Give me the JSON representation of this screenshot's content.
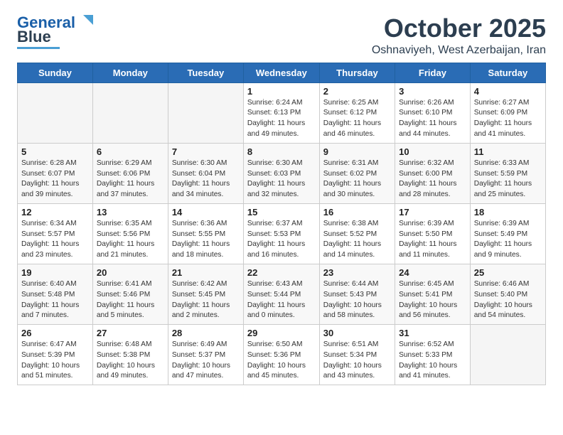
{
  "logo": {
    "line1": "General",
    "line2": "Blue"
  },
  "header": {
    "title": "October 2025",
    "subtitle": "Oshnaviyeh, West Azerbaijan, Iran"
  },
  "weekdays": [
    "Sunday",
    "Monday",
    "Tuesday",
    "Wednesday",
    "Thursday",
    "Friday",
    "Saturday"
  ],
  "weeks": [
    [
      {
        "day": "",
        "info": ""
      },
      {
        "day": "",
        "info": ""
      },
      {
        "day": "",
        "info": ""
      },
      {
        "day": "1",
        "info": "Sunrise: 6:24 AM\nSunset: 6:13 PM\nDaylight: 11 hours\nand 49 minutes."
      },
      {
        "day": "2",
        "info": "Sunrise: 6:25 AM\nSunset: 6:12 PM\nDaylight: 11 hours\nand 46 minutes."
      },
      {
        "day": "3",
        "info": "Sunrise: 6:26 AM\nSunset: 6:10 PM\nDaylight: 11 hours\nand 44 minutes."
      },
      {
        "day": "4",
        "info": "Sunrise: 6:27 AM\nSunset: 6:09 PM\nDaylight: 11 hours\nand 41 minutes."
      }
    ],
    [
      {
        "day": "5",
        "info": "Sunrise: 6:28 AM\nSunset: 6:07 PM\nDaylight: 11 hours\nand 39 minutes."
      },
      {
        "day": "6",
        "info": "Sunrise: 6:29 AM\nSunset: 6:06 PM\nDaylight: 11 hours\nand 37 minutes."
      },
      {
        "day": "7",
        "info": "Sunrise: 6:30 AM\nSunset: 6:04 PM\nDaylight: 11 hours\nand 34 minutes."
      },
      {
        "day": "8",
        "info": "Sunrise: 6:30 AM\nSunset: 6:03 PM\nDaylight: 11 hours\nand 32 minutes."
      },
      {
        "day": "9",
        "info": "Sunrise: 6:31 AM\nSunset: 6:02 PM\nDaylight: 11 hours\nand 30 minutes."
      },
      {
        "day": "10",
        "info": "Sunrise: 6:32 AM\nSunset: 6:00 PM\nDaylight: 11 hours\nand 28 minutes."
      },
      {
        "day": "11",
        "info": "Sunrise: 6:33 AM\nSunset: 5:59 PM\nDaylight: 11 hours\nand 25 minutes."
      }
    ],
    [
      {
        "day": "12",
        "info": "Sunrise: 6:34 AM\nSunset: 5:57 PM\nDaylight: 11 hours\nand 23 minutes."
      },
      {
        "day": "13",
        "info": "Sunrise: 6:35 AM\nSunset: 5:56 PM\nDaylight: 11 hours\nand 21 minutes."
      },
      {
        "day": "14",
        "info": "Sunrise: 6:36 AM\nSunset: 5:55 PM\nDaylight: 11 hours\nand 18 minutes."
      },
      {
        "day": "15",
        "info": "Sunrise: 6:37 AM\nSunset: 5:53 PM\nDaylight: 11 hours\nand 16 minutes."
      },
      {
        "day": "16",
        "info": "Sunrise: 6:38 AM\nSunset: 5:52 PM\nDaylight: 11 hours\nand 14 minutes."
      },
      {
        "day": "17",
        "info": "Sunrise: 6:39 AM\nSunset: 5:50 PM\nDaylight: 11 hours\nand 11 minutes."
      },
      {
        "day": "18",
        "info": "Sunrise: 6:39 AM\nSunset: 5:49 PM\nDaylight: 11 hours\nand 9 minutes."
      }
    ],
    [
      {
        "day": "19",
        "info": "Sunrise: 6:40 AM\nSunset: 5:48 PM\nDaylight: 11 hours\nand 7 minutes."
      },
      {
        "day": "20",
        "info": "Sunrise: 6:41 AM\nSunset: 5:46 PM\nDaylight: 11 hours\nand 5 minutes."
      },
      {
        "day": "21",
        "info": "Sunrise: 6:42 AM\nSunset: 5:45 PM\nDaylight: 11 hours\nand 2 minutes."
      },
      {
        "day": "22",
        "info": "Sunrise: 6:43 AM\nSunset: 5:44 PM\nDaylight: 11 hours\nand 0 minutes."
      },
      {
        "day": "23",
        "info": "Sunrise: 6:44 AM\nSunset: 5:43 PM\nDaylight: 10 hours\nand 58 minutes."
      },
      {
        "day": "24",
        "info": "Sunrise: 6:45 AM\nSunset: 5:41 PM\nDaylight: 10 hours\nand 56 minutes."
      },
      {
        "day": "25",
        "info": "Sunrise: 6:46 AM\nSunset: 5:40 PM\nDaylight: 10 hours\nand 54 minutes."
      }
    ],
    [
      {
        "day": "26",
        "info": "Sunrise: 6:47 AM\nSunset: 5:39 PM\nDaylight: 10 hours\nand 51 minutes."
      },
      {
        "day": "27",
        "info": "Sunrise: 6:48 AM\nSunset: 5:38 PM\nDaylight: 10 hours\nand 49 minutes."
      },
      {
        "day": "28",
        "info": "Sunrise: 6:49 AM\nSunset: 5:37 PM\nDaylight: 10 hours\nand 47 minutes."
      },
      {
        "day": "29",
        "info": "Sunrise: 6:50 AM\nSunset: 5:36 PM\nDaylight: 10 hours\nand 45 minutes."
      },
      {
        "day": "30",
        "info": "Sunrise: 6:51 AM\nSunset: 5:34 PM\nDaylight: 10 hours\nand 43 minutes."
      },
      {
        "day": "31",
        "info": "Sunrise: 6:52 AM\nSunset: 5:33 PM\nDaylight: 10 hours\nand 41 minutes."
      },
      {
        "day": "",
        "info": ""
      }
    ]
  ]
}
